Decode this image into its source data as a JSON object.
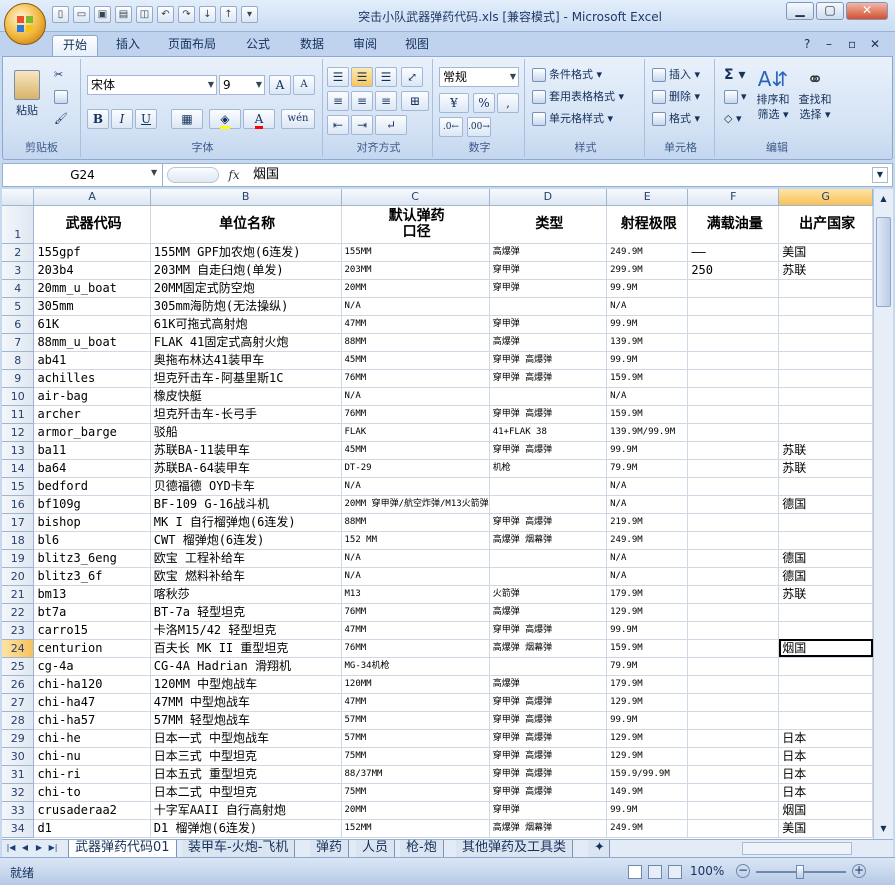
{
  "window": {
    "title": "突击小队武器弹药代码.xls  [兼容模式] - Microsoft Excel"
  },
  "ribbon_tabs": [
    "开始",
    "插入",
    "页面布局",
    "公式",
    "数据",
    "审阅",
    "视图"
  ],
  "ribbon": {
    "clipboard": {
      "label": "剪贴板",
      "paste": "粘贴"
    },
    "font": {
      "label": "字体",
      "name": "宋体",
      "size": "9",
      "bold": "B",
      "italic": "I",
      "underline": "U",
      "grow": "A",
      "shrink": "A",
      "phonetic": "wén"
    },
    "alignment": {
      "label": "对齐方式"
    },
    "number": {
      "label": "数字",
      "format": "常规",
      "percent": "%",
      "comma": ","
    },
    "styles": {
      "label": "样式",
      "conditional": "条件格式",
      "table": "套用表格格式",
      "cell": "单元格样式"
    },
    "cells": {
      "label": "单元格",
      "insert": "插入",
      "delete": "删除",
      "format": "格式"
    },
    "editing": {
      "label": "编辑",
      "sum": "Σ",
      "sort1": "排序和",
      "sort2": "筛选",
      "find1": "查找和",
      "find2": "选择"
    }
  },
  "formula_bar": {
    "name_box": "G24",
    "fx": "fx",
    "value": "烟国"
  },
  "columns": [
    "A",
    "B",
    "C",
    "D",
    "E",
    "F",
    "G"
  ],
  "header_row": [
    "武器代码",
    "单位名称",
    "默认弹药\n口径",
    "类型",
    "射程极限",
    "满载油量",
    "出产国家"
  ],
  "rows": [
    [
      "155gpf",
      "155MM GPF加农炮(6连发)",
      "155MM",
      "高爆弹",
      "249.9M",
      "——",
      "美国"
    ],
    [
      "203b4",
      "203MM 自走臼炮(单发)",
      "203MM",
      "穿甲弹",
      "299.9M",
      "250",
      "苏联"
    ],
    [
      "20mm_u_boat",
      "20MM固定式防空炮",
      "20MM",
      "穿甲弹",
      "99.9M",
      "",
      ""
    ],
    [
      "305mm",
      "305mm海防炮(无法操纵)",
      "N/A",
      "",
      "N/A",
      "",
      ""
    ],
    [
      "61K",
      "61K可拖式高射炮",
      "47MM",
      "穿甲弹",
      "99.9M",
      "",
      ""
    ],
    [
      "88mm_u_boat",
      "FLAK 41固定式高射火炮",
      "88MM",
      "高爆弹",
      "139.9M",
      "",
      ""
    ],
    [
      "ab41",
      "奥拖布林达41装甲车",
      "45MM",
      "穿甲弹 高爆弹",
      "99.9M",
      "",
      ""
    ],
    [
      "achilles",
      "坦克歼击车-阿基里斯1C",
      "76MM",
      "穿甲弹 高爆弹",
      "159.9M",
      "",
      ""
    ],
    [
      "air-bag",
      "橡皮快艇",
      "N/A",
      "",
      "N/A",
      "",
      ""
    ],
    [
      "archer",
      "坦克歼击车-长弓手",
      "76MM",
      "穿甲弹 高爆弹",
      "159.9M",
      "",
      ""
    ],
    [
      "armor_barge",
      "驳船",
      "FLAK",
      "41+FLAK 38",
      "139.9M/99.9M",
      "",
      ""
    ],
    [
      "ba11",
      "苏联BA-11装甲车",
      "45MM",
      "穿甲弹 高爆弹",
      "99.9M",
      "",
      "苏联"
    ],
    [
      "ba64",
      "苏联BA-64装甲车",
      "DT-29",
      "机枪",
      "79.9M",
      "",
      "苏联"
    ],
    [
      "bedford",
      "贝德福德 OYD卡车",
      "N/A",
      "",
      "N/A",
      "",
      ""
    ],
    [
      "bf109g",
      "BF-109 G-16战斗机",
      "20MM 穿甲弹/航空炸弹/M13火箭弹",
      "",
      "N/A",
      "",
      "德国"
    ],
    [
      "bishop",
      "MK I 自行榴弹炮(6连发)",
      "88MM",
      "穿甲弹 高爆弹",
      "219.9M",
      "",
      ""
    ],
    [
      "bl6",
      "CWT 榴弹炮(6连发)",
      "152 MM",
      "高爆弹 烟幕弹",
      "249.9M",
      "",
      ""
    ],
    [
      "blitz3_6eng",
      "欧宝 工程补给车",
      "N/A",
      "",
      "N/A",
      "",
      "德国"
    ],
    [
      "blitz3_6f",
      "欧宝 燃料补给车",
      "N/A",
      "",
      "N/A",
      "",
      "德国"
    ],
    [
      "bm13",
      "喀秋莎",
      "M13",
      "火箭弹",
      "179.9M",
      "",
      "苏联"
    ],
    [
      "bt7a",
      "BT-7a 轻型坦克",
      "76MM",
      "高爆弹",
      "129.9M",
      "",
      ""
    ],
    [
      "carro15",
      "卡洛M15/42 轻型坦克",
      "47MM",
      "穿甲弹 高爆弹",
      "99.9M",
      "",
      ""
    ],
    [
      "centurion",
      "百夫长 MK II 重型坦克",
      "76MM",
      "高爆弹 烟幕弹",
      "159.9M",
      "",
      "烟国"
    ],
    [
      "cg-4a",
      "CG-4A Hadrian 滑翔机",
      "MG-34机枪",
      "",
      "79.9M",
      "",
      ""
    ],
    [
      "chi-ha120",
      "120MM 中型炮战车",
      "120MM",
      "高爆弹",
      "179.9M",
      "",
      ""
    ],
    [
      "chi-ha47",
      "47MM 中型炮战车",
      "47MM",
      "穿甲弹 高爆弹",
      "129.9M",
      "",
      ""
    ],
    [
      "chi-ha57",
      "57MM 轻型炮战车",
      "57MM",
      "穿甲弹 高爆弹",
      "99.9M",
      "",
      ""
    ],
    [
      "chi-he",
      "日本一式 中型炮战车",
      "57MM",
      "穿甲弹 高爆弹",
      "129.9M",
      "",
      "日本"
    ],
    [
      "chi-nu",
      "日本三式 中型坦克",
      "75MM",
      "穿甲弹 高爆弹",
      "129.9M",
      "",
      "日本"
    ],
    [
      "chi-ri",
      "日本五式 重型坦克",
      "88/37MM",
      "穿甲弹 高爆弹",
      "159.9/99.9M",
      "",
      "日本"
    ],
    [
      "chi-to",
      "日本二式 中型坦克",
      "75MM",
      "穿甲弹 高爆弹",
      "149.9M",
      "",
      "日本"
    ],
    [
      "crusaderaa2",
      "十字军AAII 自行高射炮",
      "20MM",
      "穿甲弹",
      "99.9M",
      "",
      "烟国"
    ],
    [
      "d1",
      "D1 榴弹炮(6连发)",
      "152MM",
      "高爆弹 烟幕弹",
      "249.9M",
      "",
      "美国"
    ]
  ],
  "sheet_tabs": [
    "武器弹药代码01",
    "装甲车-火炮-飞机",
    "弹药",
    "人员",
    "枪-炮",
    "其他弹药及工具类"
  ],
  "status": {
    "mode": "就绪",
    "zoom": "100%"
  }
}
